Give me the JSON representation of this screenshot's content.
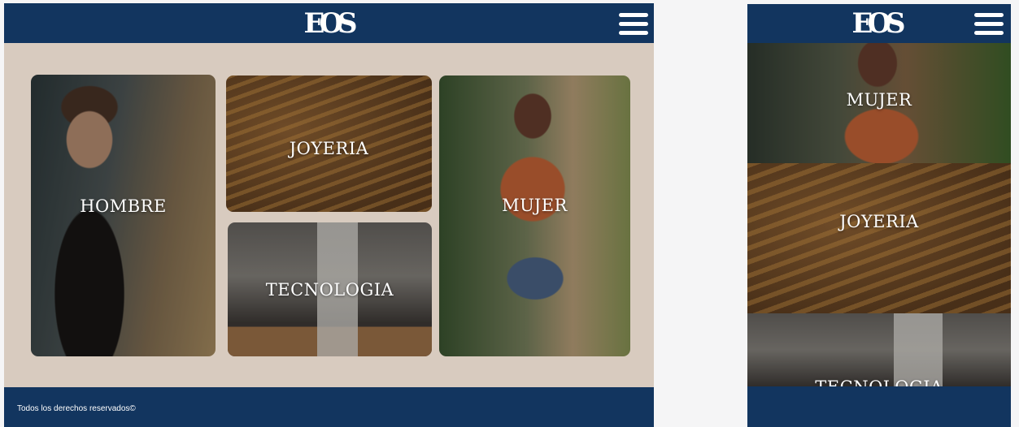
{
  "brand": {
    "logo_text": "EOS"
  },
  "categories": {
    "hombre": "HOMBRE",
    "joyeria": "JOYERIA",
    "tecnologia": "TECNOLOGIA",
    "mujer": "MUJER"
  },
  "footer": {
    "text": "Todos los derechos reservados©"
  },
  "colors": {
    "header": "#12355f",
    "page_background": "#d8cbbf",
    "canvas_background": "#f5f5f6"
  },
  "icons": {
    "menu": "hamburger-menu-icon"
  }
}
